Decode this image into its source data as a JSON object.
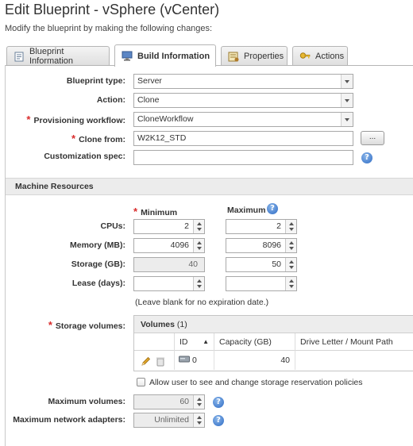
{
  "page": {
    "title": "Edit Blueprint - vSphere (vCenter)",
    "subtitle": "Modify the blueprint by making the following changes:"
  },
  "tabs": [
    {
      "label": "Blueprint Information",
      "icon": "document-icon",
      "active": false
    },
    {
      "label": "Build Information",
      "icon": "computer-icon",
      "active": true
    },
    {
      "label": "Properties",
      "icon": "properties-icon",
      "active": false
    },
    {
      "label": "Actions",
      "icon": "key-icon",
      "active": false
    }
  ],
  "build": {
    "blueprint_type_label": "Blueprint type:",
    "blueprint_type_value": "Server",
    "action_label": "Action:",
    "action_value": "Clone",
    "provisioning_workflow_label": "Provisioning workflow:",
    "provisioning_workflow_value": "CloneWorkflow",
    "clone_from_label": "Clone from:",
    "clone_from_value": "W2K12_STD",
    "browse_label": "...",
    "customization_spec_label": "Customization spec:",
    "customization_spec_value": ""
  },
  "machine_resources": {
    "section_title": "Machine Resources",
    "minimum_header": "Minimum",
    "maximum_header": "Maximum",
    "cpus_label": "CPUs:",
    "cpus_min": "2",
    "cpus_max": "2",
    "memory_label": "Memory (MB):",
    "memory_min": "4096",
    "memory_max": "8096",
    "storage_label": "Storage (GB):",
    "storage_min": "40",
    "storage_max": "50",
    "lease_label": "Lease (days):",
    "lease_min": "",
    "lease_max": "",
    "lease_note": "(Leave blank for no expiration date.)"
  },
  "storage_volumes": {
    "label": "Storage volumes:",
    "grid_title": "Volumes",
    "grid_count": "(1)",
    "columns": [
      "ID",
      "Capacity (GB)",
      "Drive Letter / Mount Path"
    ],
    "rows": [
      {
        "id": "0",
        "capacity": "40",
        "drive": ""
      }
    ],
    "allow_policy_label": "Allow user to see and change storage reservation policies",
    "allow_policy_checked": false
  },
  "limits": {
    "max_volumes_label": "Maximum volumes:",
    "max_volumes_value": "60",
    "max_network_label": "Maximum network adapters:",
    "max_network_value": "Unlimited"
  },
  "colors": {
    "required": "#d92c2c",
    "help": "#2e6bc4"
  }
}
